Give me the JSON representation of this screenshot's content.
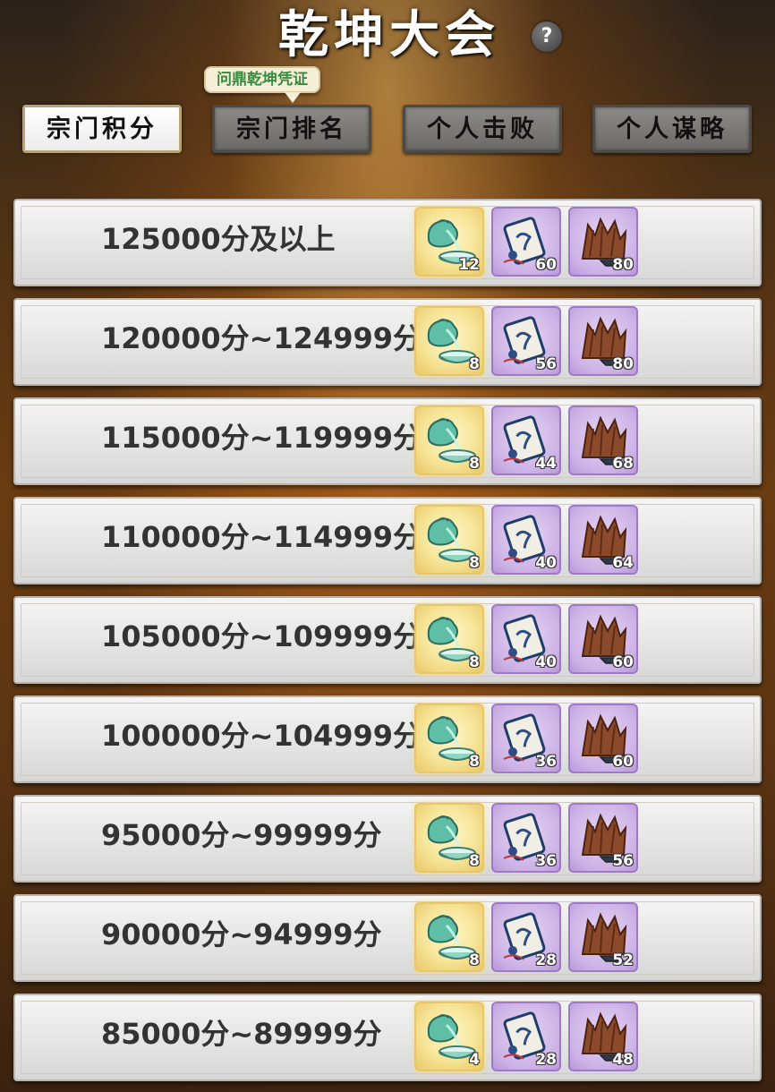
{
  "header": {
    "title": "乾坤大会",
    "help_label": "?",
    "tooltip": "问鼎乾坤凭证"
  },
  "tabs": [
    {
      "label": "宗门积分",
      "active": true
    },
    {
      "label": "宗门排名",
      "active": false
    },
    {
      "label": "个人击败",
      "active": false
    },
    {
      "label": "个人谋略",
      "active": false
    }
  ],
  "reward_icons": [
    "pouch-and-bowl-icon",
    "scroll-icon",
    "timber-icon"
  ],
  "colors": {
    "active_tab": "#ffffff",
    "inactive_tab": "#7b7976",
    "gold_slot": "#f6e497",
    "purple_slot": "#cdb2e6"
  },
  "rows": [
    {
      "range": "125000分及以上",
      "rewards": [
        "12",
        "60",
        "80"
      ]
    },
    {
      "range": "120000分~124999分",
      "rewards": [
        "8",
        "56",
        "80"
      ]
    },
    {
      "range": "115000分~119999分",
      "rewards": [
        "8",
        "44",
        "68"
      ]
    },
    {
      "range": "110000分~114999分",
      "rewards": [
        "8",
        "40",
        "64"
      ]
    },
    {
      "range": "105000分~109999分",
      "rewards": [
        "8",
        "40",
        "60"
      ]
    },
    {
      "range": "100000分~104999分",
      "rewards": [
        "8",
        "36",
        "60"
      ]
    },
    {
      "range": "95000分~99999分",
      "rewards": [
        "8",
        "36",
        "56"
      ]
    },
    {
      "range": "90000分~94999分",
      "rewards": [
        "8",
        "28",
        "52"
      ]
    },
    {
      "range": "85000分~89999分",
      "rewards": [
        "4",
        "28",
        "48"
      ]
    }
  ]
}
